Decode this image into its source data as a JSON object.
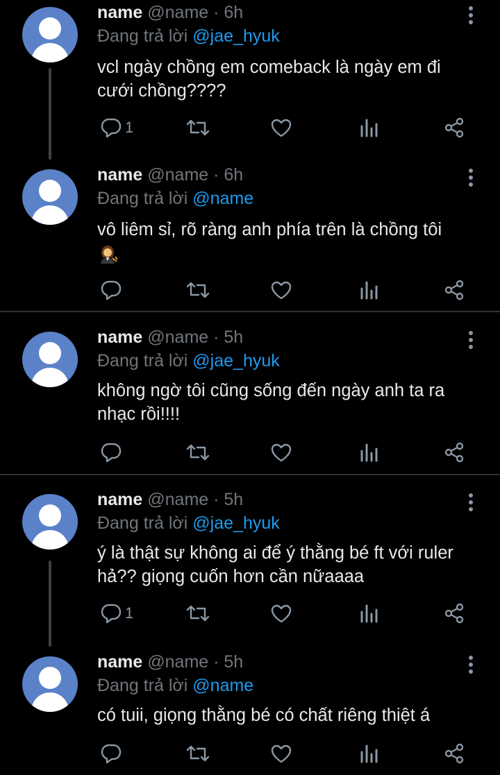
{
  "colors": {
    "accent": "#1d9bf0",
    "background": "#000000",
    "text": "#e7e9ea",
    "muted": "#71767b",
    "avatar": "#5b82c9"
  },
  "tweets": [
    {
      "name": "name",
      "meta": "@name · 6h",
      "reply_prefix": "Đang trả lời",
      "reply_handle": "@jae_hyuk",
      "text_lines": [
        "vcl ngày chồng em comeback là ngày em đi",
        "cưới chồng????"
      ],
      "reply_count": "1"
    },
    {
      "name": "name",
      "meta": "@name · 6h",
      "reply_prefix": "Đang trả lời",
      "reply_handle": "@name",
      "text_lines": [
        "vô liêm sỉ, rõ ràng anh phía trên là chồng tôi",
        ""
      ],
      "emoji": "woman-judge-emoji",
      "reply_count": ""
    },
    {
      "name": "name",
      "meta": "@name · 5h",
      "reply_prefix": "Đang trả lời",
      "reply_handle": "@jae_hyuk",
      "text_lines": [
        "không ngờ tôi cũng sống đến ngày anh ta ra",
        "nhạc rồi!!!!"
      ],
      "reply_count": ""
    },
    {
      "name": "name",
      "meta": "@name · 5h",
      "reply_prefix": "Đang trả lời",
      "reply_handle": "@jae_hyuk",
      "text_lines": [
        "ý là thật sự không ai để ý thằng bé ft với ruler",
        "hả?? giọng cuốn hơn cần nữaaaa"
      ],
      "reply_count": "1"
    },
    {
      "name": "name",
      "meta": "@name · 5h",
      "reply_prefix": "Đang trả lời",
      "reply_handle": "@name",
      "text_lines": [
        "có tuii, giọng thằng bé có chất riêng thiệt á"
      ],
      "reply_count": ""
    }
  ],
  "icons": [
    "reply-icon",
    "retweet-icon",
    "like-icon",
    "analytics-icon",
    "share-icon",
    "more-options-icon"
  ]
}
